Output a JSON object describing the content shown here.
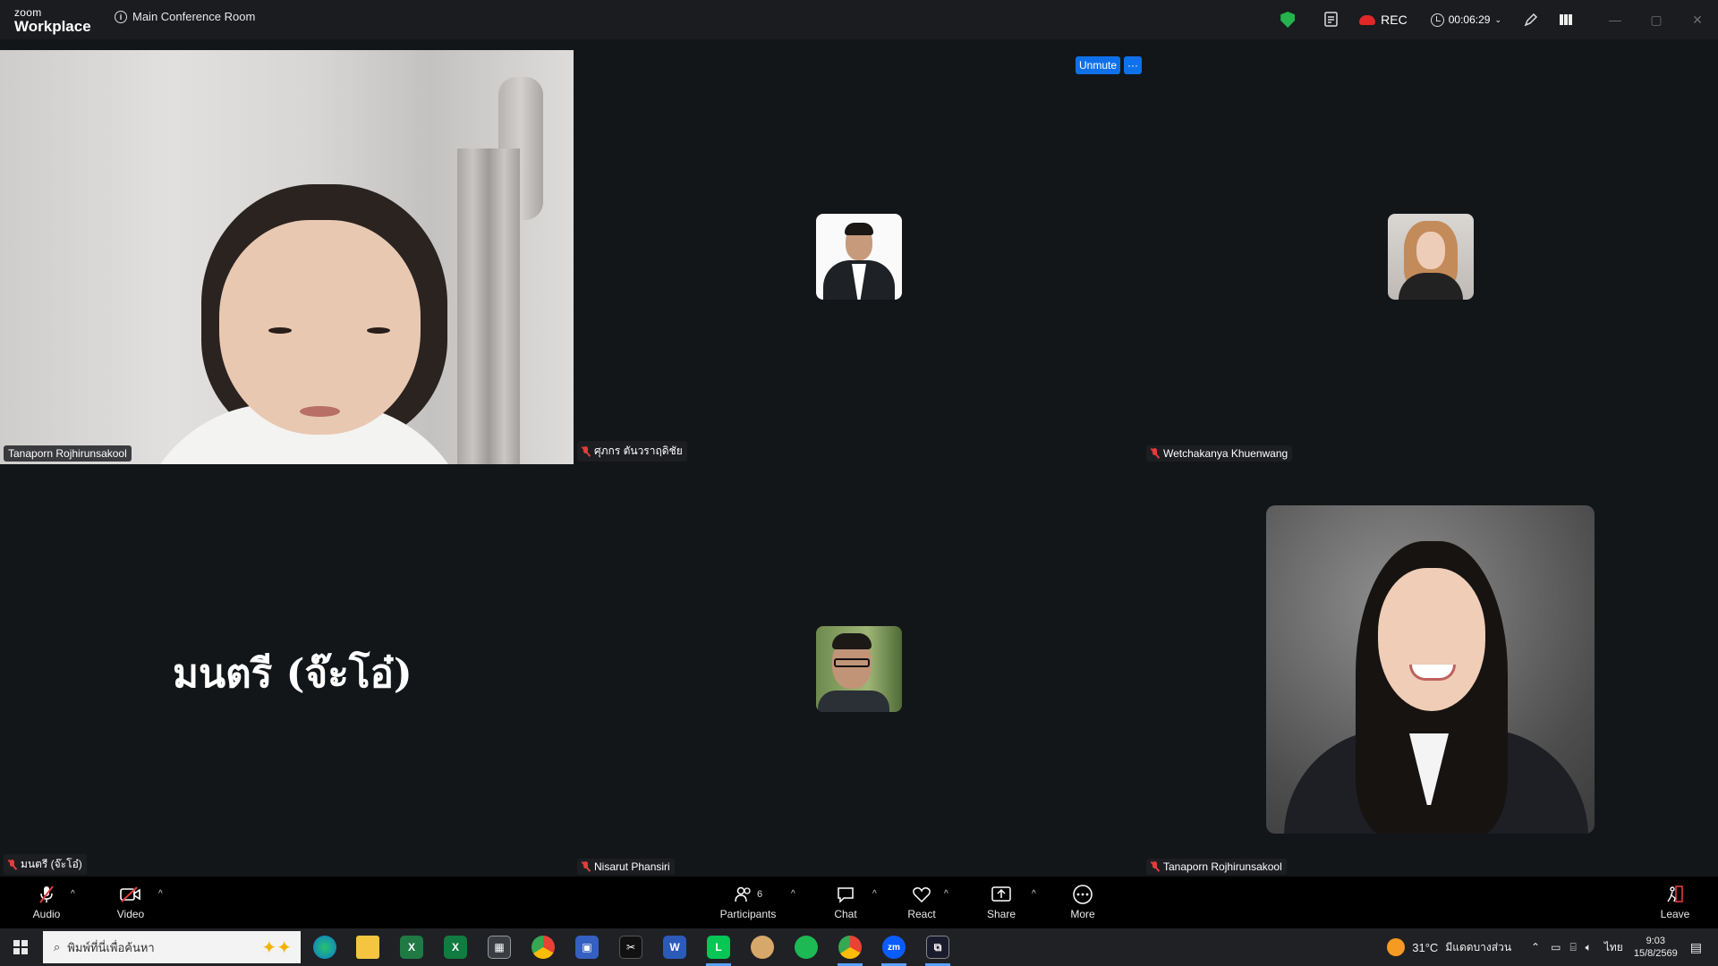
{
  "titlebar": {
    "logo_small": "zoom",
    "logo_large": "Workplace",
    "meeting_name": "Main Conference Room",
    "rec_label": "REC",
    "timer": "00:06:29"
  },
  "participants": [
    {
      "name": "Tanaporn Rojhirunsakool",
      "muted": false
    },
    {
      "name": "ศุภกร ตันวราฤดิชัย",
      "muted": true
    },
    {
      "name": "Wetchakanya Khuenwang",
      "muted": true
    },
    {
      "name": "มนตรี (จ๊ะโอ๋)",
      "muted": true
    },
    {
      "name": "Nisarut Phansiri",
      "muted": true
    },
    {
      "name": "Tanaporn Rojhirunsakool",
      "muted": true
    }
  ],
  "big_name": "มนตรี (จ๊ะโอ๋)",
  "unmute_label": "Unmute",
  "more_dots": "···",
  "toolbar": {
    "audio": "Audio",
    "video": "Video",
    "participants": "Participants",
    "participants_count": "6",
    "chat": "Chat",
    "react": "React",
    "share": "Share",
    "more": "More",
    "leave": "Leave"
  },
  "taskbar": {
    "search_placeholder": "พิมพ์ที่นี่เพื่อค้นหา",
    "weather": "31°C",
    "weather_desc": "มีแดดบางส่วน",
    "lang": "ไทย",
    "time": "9:03",
    "date": "15/8/2569"
  },
  "colors": {
    "active_speaker": "#2ed17b",
    "accent": "#0e71eb",
    "rec": "#e02828",
    "muted": "#e23c3c"
  }
}
